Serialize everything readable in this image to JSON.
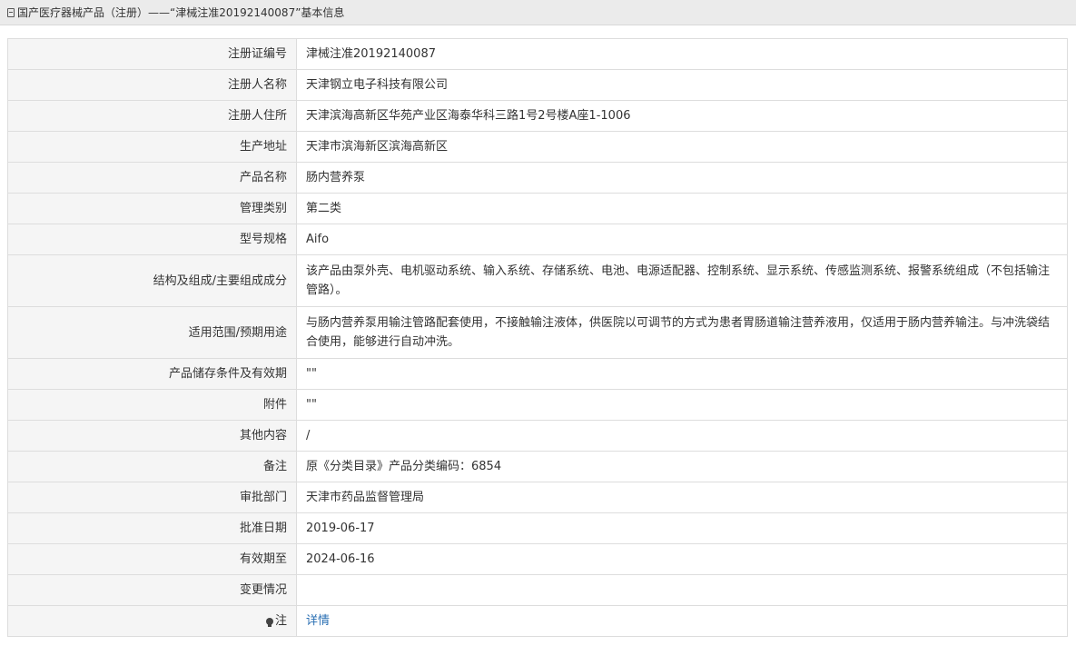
{
  "breadcrumb": "国产医疗器械产品（注册）——“津械注准20192140087”基本信息",
  "rows": [
    {
      "label": "注册证编号",
      "value": "津械注准20192140087"
    },
    {
      "label": "注册人名称",
      "value": "天津钢立电子科技有限公司"
    },
    {
      "label": "注册人住所",
      "value": "天津滨海高新区华苑产业区海泰华科三路1号2号楼A座1-1006"
    },
    {
      "label": "生产地址",
      "value": "天津市滨海新区滨海高新区"
    },
    {
      "label": "产品名称",
      "value": "肠内营养泵"
    },
    {
      "label": "管理类别",
      "value": "第二类"
    },
    {
      "label": "型号规格",
      "value": "Aifo"
    },
    {
      "label": "结构及组成/主要组成成分",
      "value": "该产品由泵外壳、电机驱动系统、输入系统、存储系统、电池、电源适配器、控制系统、显示系统、传感监测系统、报警系统组成（不包括输注管路）。"
    },
    {
      "label": "适用范围/预期用途",
      "value": "与肠内营养泵用输注管路配套使用，不接触输注液体，供医院以可调节的方式为患者胃肠道输注营养液用，仅适用于肠内营养输注。与冲洗袋结合使用，能够进行自动冲洗。"
    },
    {
      "label": "产品储存条件及有效期",
      "value": "\"\""
    },
    {
      "label": "附件",
      "value": "\"\""
    },
    {
      "label": "其他内容",
      "value": "/"
    },
    {
      "label": "备注",
      "value": "原《分类目录》产品分类编码：6854"
    },
    {
      "label": "审批部门",
      "value": "天津市药品监督管理局"
    },
    {
      "label": "批准日期",
      "value": "2019-06-17"
    },
    {
      "label": "有效期至",
      "value": "2024-06-16"
    },
    {
      "label": "变更情况",
      "value": ""
    }
  ],
  "note": {
    "label": "注",
    "link": "详情",
    "icon": "lightbulb-icon"
  }
}
